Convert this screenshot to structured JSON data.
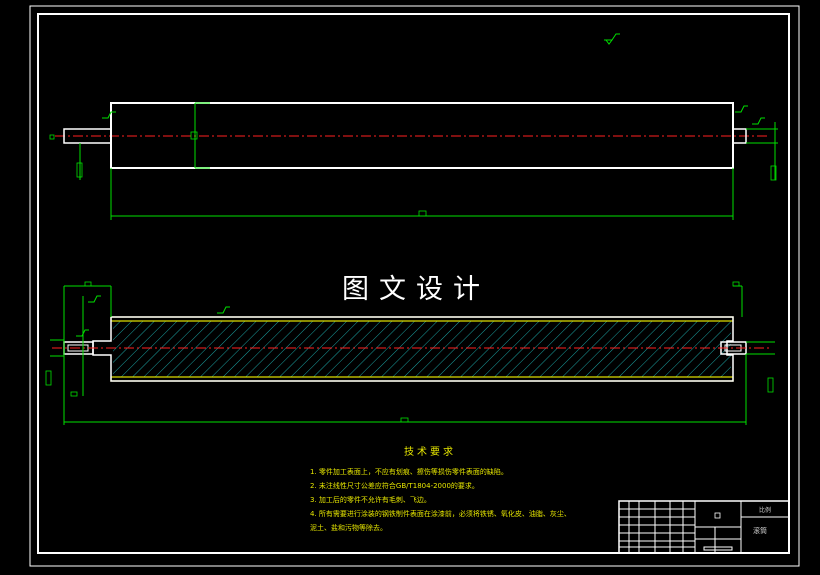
{
  "watermark": "图文设计",
  "tech_title": "技术要求",
  "tech_notes": [
    "1. 零件加工表面上，不应有划痕、擦伤等损伤零件表面的缺陷。",
    "2. 未注线性尺寸公差应符合GB/T1804-2000的要求。",
    "3. 加工后的零件不允许有毛刺、飞边。",
    "4. 所有需要进行涂装的钢铁制件表面在涂漆前，必须将铁锈、氧化皮、油脂、灰尘、",
    "泥土、盐和污物等除去。"
  ],
  "title_block": {
    "part_name": "滚筒",
    "scale_label": "比例",
    "drawing_no": "□"
  },
  "dimension_marks": {
    "overall_length": "□",
    "diameter": "□"
  },
  "colors": {
    "background": "#000000",
    "outline": "#ffffff",
    "dimension": "#00e000",
    "centerline": "#ff2020",
    "coating": "#e6e600",
    "hatch": "#1aa0a0"
  }
}
